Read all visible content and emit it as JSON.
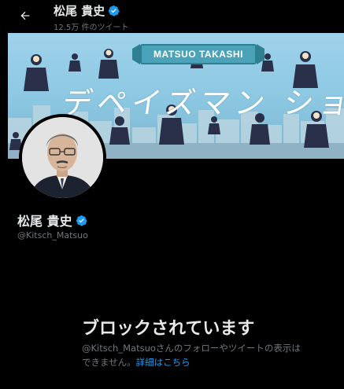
{
  "header": {
    "display_name": "松尾 貴史",
    "tweet_count": "12.5万 件のツイート"
  },
  "banner": {
    "title": "MATSUO TAKASHI",
    "catchphrase": "デペイズマン ショウ"
  },
  "profile": {
    "display_name": "松尾 貴史",
    "handle": "@Kitsch_Matsuo"
  },
  "blocked": {
    "title": "ブロックされています",
    "message_line1": "@Kitsch_Matsuoさんのフォローやツイートの表示は",
    "message_line2_prefix": "できません。",
    "link_text": "詳細はこちら"
  },
  "colors": {
    "background": "#000000",
    "text_primary": "#e7e9ea",
    "text_secondary": "#71767b",
    "link": "#1d9bf0",
    "verified": "#1d9bf0",
    "banner_sky": "#9ed2ea"
  },
  "icons": {
    "back": "arrow-left-icon",
    "verified": "verified-badge-icon"
  }
}
